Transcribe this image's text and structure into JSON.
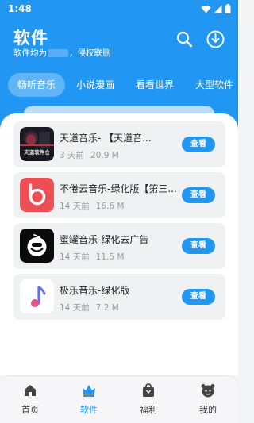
{
  "status_bar": {
    "time": "1:48",
    "icons": [
      "wifi-icon",
      "signal-icon",
      "battery-icon"
    ]
  },
  "header": {
    "title": "软件",
    "subtitle_prefix": "软件均为",
    "subtitle_suffix": "，侵权联删",
    "actions": [
      "search-icon",
      "download-icon"
    ]
  },
  "tabs": [
    {
      "label": "畅听音乐",
      "active": true
    },
    {
      "label": "小说漫画",
      "active": false
    },
    {
      "label": "看看世界",
      "active": false
    },
    {
      "label": "大型软件",
      "active": false
    }
  ],
  "apps": [
    {
      "title": "天道音乐-    【天道音...",
      "time": "3 天前",
      "size": "20.9 M",
      "button": "查看",
      "icon": "tiandao-app-icon",
      "icon_text": "天道软件仓"
    },
    {
      "title": "不倦云音乐-绿化版【第三...",
      "time": "14 天前",
      "size": "16.6 M",
      "button": "查看",
      "icon": "bujuan-app-icon"
    },
    {
      "title": "蜜罐音乐-绿化去广告",
      "time": "14 天前",
      "size": "11.5 M",
      "button": "查看",
      "icon": "miguan-app-icon"
    },
    {
      "title": "极乐音乐-绿化版",
      "time": "14 天前",
      "size": "7.2 M",
      "button": "查看",
      "icon": "jile-app-icon"
    }
  ],
  "bottom_nav": [
    {
      "label": "首页",
      "icon": "home-icon",
      "active": false
    },
    {
      "label": "软件",
      "icon": "software-icon",
      "active": true
    },
    {
      "label": "福利",
      "icon": "bag-icon",
      "active": false
    },
    {
      "label": "我的",
      "icon": "profile-icon",
      "active": false
    }
  ],
  "colors": {
    "primary": "#2196f3",
    "tab_active_bg": "#5fb5f7",
    "card_bg": "#f0f1f3",
    "meta_text": "#9a9a9a"
  }
}
